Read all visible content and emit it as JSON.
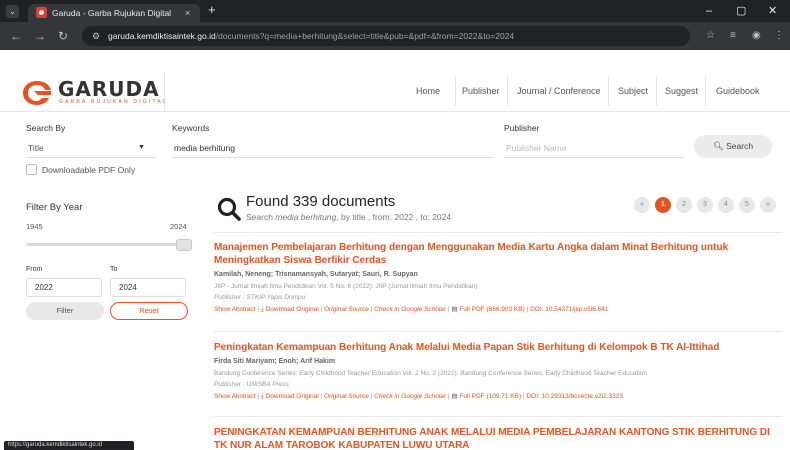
{
  "browser": {
    "tab_title": "Garuda - Garba Rujukan Digital",
    "tab_close": "×",
    "new_tab": "+",
    "menu": "⌄",
    "url_host": "garuda.kemdiktisaintek.go.id",
    "url_path": "/documents?q=media+berhitung&select=title&pub=&pdf=&from=2022&to=2024",
    "nav_back": "←",
    "nav_forward": "→",
    "nav_reload": "↻",
    "minimize": "–",
    "maximize": "▢",
    "close": "✕",
    "status_tip": "https://garuda.kemdiktisaintek.go.id"
  },
  "header": {
    "logo_text": "GARUDA",
    "logo_sub": "GARBA RUJUKAN DIGITAL",
    "nav": [
      "Home",
      "Publisher",
      "Journal / Conference",
      "Subject",
      "Suggest",
      "Guidebook"
    ]
  },
  "search": {
    "search_by_label": "Search By",
    "search_by_value": "Title",
    "keywords_label": "Keywords",
    "keywords_value": "media berhitung",
    "publisher_label": "Publisher",
    "publisher_placeholder": "Publisher Name",
    "search_button": "Search",
    "downloadable_label": "Downloadable PDF Only"
  },
  "filter": {
    "title": "Filter By Year",
    "min_year": "1945",
    "max_year": "2024",
    "from_label": "From",
    "to_label": "To",
    "from_value": "2022",
    "to_value": "2024",
    "filter_button": "Filter",
    "reset_button": "Reset"
  },
  "results": {
    "found_title": "Found 339 documents",
    "sub_prefix": "Search ",
    "sub_query": "media berhitung",
    "sub_suffix": ", by title , from: 2022 , to: 2024",
    "pagination": [
      "«",
      "1",
      "2",
      "3",
      "4",
      "5",
      "»"
    ],
    "active_page": "1",
    "items": [
      {
        "title": "Manajemen Pembelajaran Berhitung dengan Menggunakan Media Kartu Angka dalam Minat Berhitung untuk Meningkatkan Siswa Berfikir Cerdas",
        "authors": "Kamilah, Neneng; Trisnamansyah, Sutaryat; Sauri, R. Supyan",
        "meta": "JIIP - Jurnal Ilmiah Ilmu Pendidikan Vol. 5 No. 6 (2022): JIIP (Jurnal Ilmiah Ilmu Pendidikan)",
        "publisher": "Publisher : STKIP Yapis Dompu",
        "show_abstract": "Show Abstract",
        "download": "Download Original",
        "original_source": "Original Source",
        "scholar": "Check in Google Scholar",
        "full_pdf": "Full PDF (666.903 KB)",
        "doi": "DOI: 10.54371/jiip.v5i6.641"
      },
      {
        "title": "Peningkatan Kemampuan Berhitung Anak Melalui Media Papan Stik Berhitung di Kelompok B TK Al-Ittihad",
        "authors": "Firda Siti Mariyam; Enoh; Arif Hakim",
        "meta": "Bandung Conference Series: Early Childhood Teacher Education Vol. 2 No. 2 (2022): Bandung Conference Series: Early Childhood Teacher Education",
        "publisher": "Publisher : UNISBA Press",
        "show_abstract": "Show Abstract",
        "download": "Download Original",
        "original_source": "Original Source",
        "scholar": "Check in Google Scholar",
        "full_pdf": "Full PDF (109.71 KB)",
        "doi": "DOI: 10.29313/bcsecte.v2i2.3323"
      },
      {
        "title": "PENINGKATAN KEMAMPUAN BERHITUNG ANAK MELALUI MEDIA PEMBELAJARAN KANTONG STIK BERHITUNG DI TK NUR ALAM TAROBOK KABUPATEN LUWU UTARA"
      }
    ]
  },
  "colors": {
    "accent": "#e8531f",
    "chrome_dark": "#202124",
    "chrome_mid": "#35363a"
  }
}
